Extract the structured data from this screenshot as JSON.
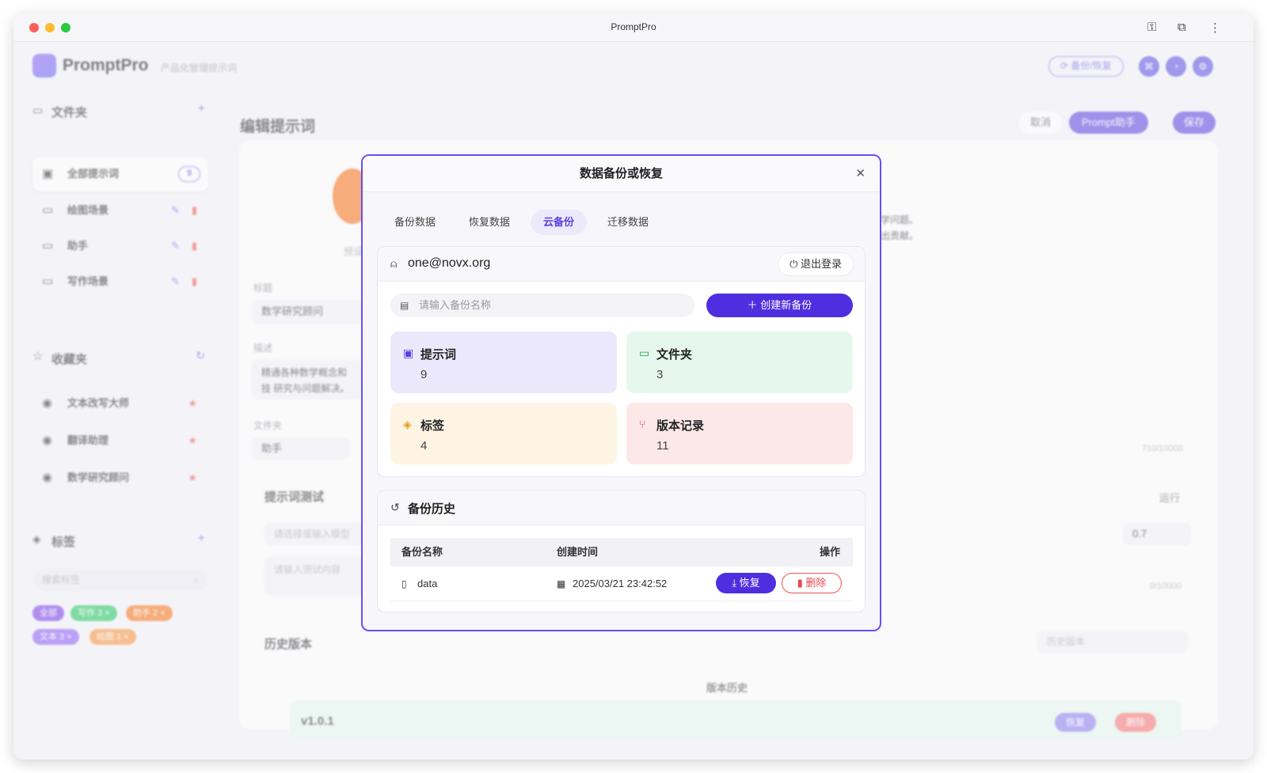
{
  "window": {
    "title": "PromptPro"
  },
  "header": {
    "app_name": "PromptPro",
    "tagline": "产品化管理提示词",
    "backup_button": "备份/恢复"
  },
  "sidebar": {
    "folders_title": "文件夹",
    "folders": [
      {
        "label": "全部提示词",
        "count": "9"
      },
      {
        "label": "绘图场景"
      },
      {
        "label": "助手"
      },
      {
        "label": "写作场景"
      }
    ],
    "favorites_title": "收藏夹",
    "favorites": [
      {
        "label": "文本改写大师"
      },
      {
        "label": "翻译助理"
      },
      {
        "label": "数学研究顾问"
      }
    ],
    "tags_title": "标签",
    "tag_search_placeholder": "搜索标签",
    "tags": [
      {
        "label": "全部",
        "color": "#7c3aed"
      },
      {
        "label": "写作 3 ×",
        "color": "#22c55e"
      },
      {
        "label": "助手 2 ×",
        "color": "#f97316"
      },
      {
        "label": "文本 3 ×",
        "color": "#8b5cf6"
      },
      {
        "label": "绘图 1 ×",
        "color": "#fb923c"
      }
    ]
  },
  "editor": {
    "page_title": "编辑提示词",
    "cancel": "取消",
    "assistant": "Prompt助手",
    "save": "保存",
    "field_title_label": "标题",
    "field_title_value": "数学研究顾问",
    "field_desc_label": "描述",
    "field_desc_value": "精通各种数学概念和技 研究与问题解决。",
    "field_folder_label": "文件夹",
    "field_folder_value": "助手",
    "content_snippet_1": "学问题。",
    "content_snippet_2": "出贡献。",
    "char_count": "710/10000",
    "test_title": "提示词测试",
    "run": "运行",
    "model_placeholder": "请选择或输入模型",
    "temperature": "0.7",
    "test_placeholder": "请输入测试内容",
    "test_count": "0/10000",
    "history_title": "历史版本",
    "history_select": "历史版本",
    "version_history": "版本历史",
    "version": "v1.0.1",
    "v_restore": "恢复",
    "v_delete": "删除",
    "preview": "预设"
  },
  "modal": {
    "title": "数据备份或恢复",
    "tabs": [
      "备份数据",
      "恢复数据",
      "云备份",
      "迁移数据"
    ],
    "account": {
      "email": "one@novx.org",
      "logout": "退出登录"
    },
    "backup_name_placeholder": "请输入备份名称",
    "create_button": "创建新备份",
    "stats": [
      {
        "label": "提示词",
        "value": "9",
        "bg": "#ece8fb",
        "icon_color": "#5b3fe0"
      },
      {
        "label": "文件夹",
        "value": "3",
        "bg": "#e6f8ee",
        "icon_color": "#16a34a"
      },
      {
        "label": "标签",
        "value": "4",
        "bg": "#fdf4e3",
        "icon_color": "#ea9a1a"
      },
      {
        "label": "版本记录",
        "value": "11",
        "bg": "#fde8e8",
        "icon_color": "#e5484d"
      }
    ],
    "history": {
      "title": "备份历史",
      "columns": [
        "备份名称",
        "创建时间",
        "操作"
      ],
      "rows": [
        {
          "name": "data",
          "time": "2025/03/21 23:42:52",
          "restore": "恢复",
          "delete": "删除"
        }
      ]
    }
  }
}
